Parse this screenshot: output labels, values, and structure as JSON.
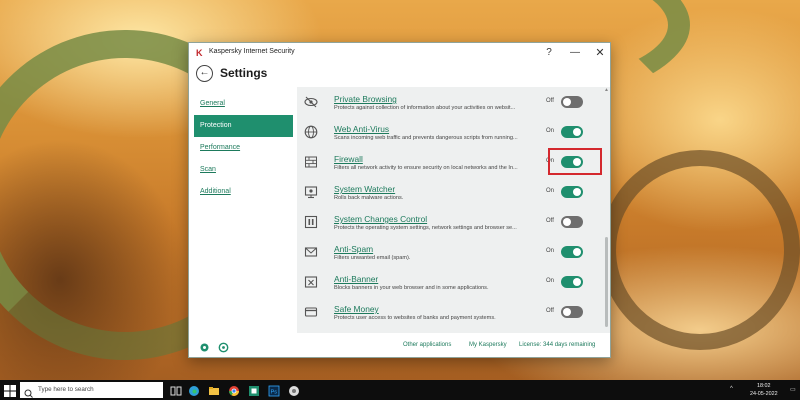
{
  "window": {
    "app_title": "Kaspersky Internet Security",
    "help_label": "?",
    "minimize_label": "—",
    "close_label": "✕"
  },
  "header": {
    "back_label": "←",
    "title": "Settings"
  },
  "sidebar": {
    "items": [
      {
        "label": "General",
        "active": false
      },
      {
        "label": "Protection",
        "active": true
      },
      {
        "label": "Performance",
        "active": false
      },
      {
        "label": "Scan",
        "active": false
      },
      {
        "label": "Additional",
        "active": false
      }
    ]
  },
  "components": [
    {
      "name": "Private Browsing",
      "desc": "Protects against collection of information about your activities on websit...",
      "state": "Off",
      "on": false,
      "icon": "eye-slash-icon"
    },
    {
      "name": "Web Anti-Virus",
      "desc": "Scans incoming web traffic and prevents dangerous scripts from running...",
      "state": "On",
      "on": true,
      "icon": "globe-icon"
    },
    {
      "name": "Firewall",
      "desc": "Filters all network activity to ensure security on local networks and the In...",
      "state": "On",
      "on": true,
      "icon": "firewall-icon"
    },
    {
      "name": "System Watcher",
      "desc": "Rolls back malware actions.",
      "state": "On",
      "on": true,
      "icon": "monitor-icon"
    },
    {
      "name": "System Changes Control",
      "desc": "Protects the operating system settings, network settings and browser se...",
      "state": "Off",
      "on": false,
      "icon": "pause-icon"
    },
    {
      "name": "Anti-Spam",
      "desc": "Filters unwanted email (spam).",
      "state": "On",
      "on": true,
      "icon": "envelope-icon"
    },
    {
      "name": "Anti-Banner",
      "desc": "Blocks banners in your web browser and in some applications.",
      "state": "On",
      "on": true,
      "icon": "banner-block-icon"
    },
    {
      "name": "Safe Money",
      "desc": "Protects user access to websites of banks and payment systems.",
      "state": "Off",
      "on": false,
      "icon": "card-icon"
    }
  ],
  "footer": {
    "other_apps": "Other applications",
    "my_kaspersky": "My Kaspersky",
    "license": "License: 344 days remaining"
  },
  "taskbar": {
    "search_placeholder": "Type here to search",
    "time": "18:02",
    "date": "24-05-2022"
  },
  "colors": {
    "accent": "#1f8f6e",
    "link": "#1d7a5c",
    "highlight": "#d4282e",
    "toggle_off": "#6e6e6e"
  }
}
